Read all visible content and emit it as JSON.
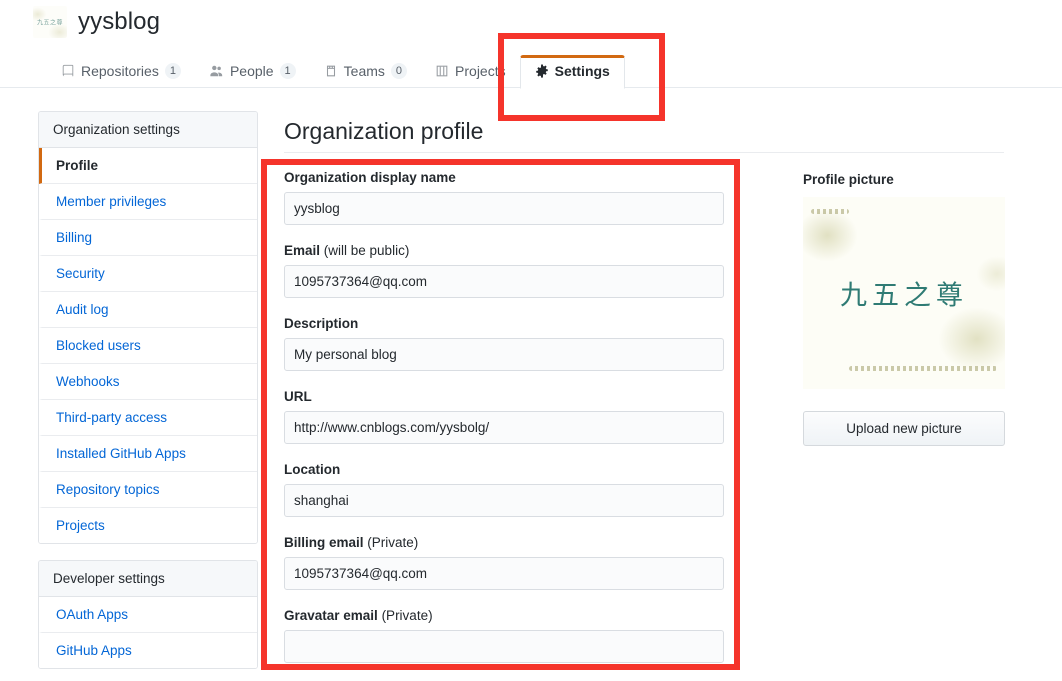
{
  "org": {
    "name": "yysblog",
    "avatar_icon": "org-avatar-image"
  },
  "nav": {
    "tabs": [
      {
        "label": "Repositories",
        "count": "1",
        "icon": "repo-icon",
        "selected": false
      },
      {
        "label": "People",
        "count": "1",
        "icon": "people-icon",
        "selected": false
      },
      {
        "label": "Teams",
        "count": "0",
        "icon": "teams-icon",
        "selected": false
      },
      {
        "label": "Projects",
        "count": "",
        "icon": "projects-icon",
        "selected": false
      },
      {
        "label": "Settings",
        "count": "",
        "icon": "gear-icon",
        "selected": true
      }
    ]
  },
  "page": {
    "title": "Organization profile"
  },
  "sidebar": {
    "groups": [
      {
        "heading": "Organization settings",
        "items": [
          {
            "label": "Profile",
            "active": true
          },
          {
            "label": "Member privileges",
            "active": false
          },
          {
            "label": "Billing",
            "active": false
          },
          {
            "label": "Security",
            "active": false
          },
          {
            "label": "Audit log",
            "active": false
          },
          {
            "label": "Blocked users",
            "active": false
          },
          {
            "label": "Webhooks",
            "active": false
          },
          {
            "label": "Third-party access",
            "active": false
          },
          {
            "label": "Installed GitHub Apps",
            "active": false
          },
          {
            "label": "Repository topics",
            "active": false
          },
          {
            "label": "Projects",
            "active": false
          }
        ]
      },
      {
        "heading": "Developer settings",
        "items": [
          {
            "label": "OAuth Apps",
            "active": false
          },
          {
            "label": "GitHub Apps",
            "active": false
          }
        ]
      }
    ]
  },
  "form": {
    "fields": [
      {
        "label": "Organization display name",
        "note": "",
        "value": "yysblog",
        "placeholder": ""
      },
      {
        "label": "Email",
        "note": " (will be public)",
        "value": "1095737364@qq.com",
        "placeholder": ""
      },
      {
        "label": "Description",
        "note": "",
        "value": "My personal blog",
        "placeholder": ""
      },
      {
        "label": "URL",
        "note": "",
        "value": "http://www.cnblogs.com/yysbolg/",
        "placeholder": ""
      },
      {
        "label": "Location",
        "note": "",
        "value": "shanghai",
        "placeholder": ""
      },
      {
        "label": "Billing email",
        "note": " (Private)",
        "value": "1095737364@qq.com",
        "placeholder": ""
      },
      {
        "label": "Gravatar email",
        "note": " (Private)",
        "value": "",
        "placeholder": ""
      }
    ]
  },
  "profile_picture": {
    "label": "Profile picture",
    "image_text": "九五之尊",
    "upload_button": "Upload new picture"
  },
  "annotations": {
    "accent_color": "#f5342b",
    "tab_accent_color": "#d26911",
    "link_color": "#0366d6"
  }
}
